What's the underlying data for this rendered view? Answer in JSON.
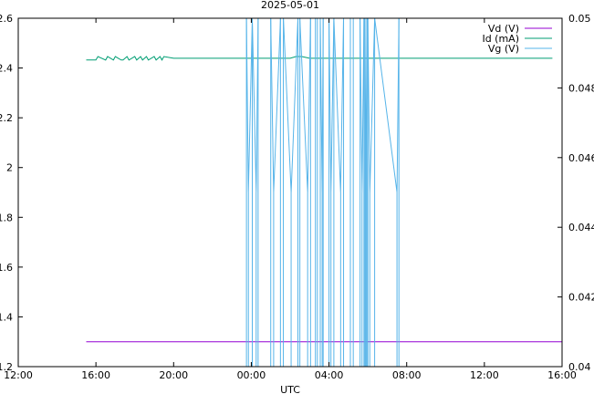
{
  "chart_data": {
    "type": "line",
    "title": "2025-05-01",
    "xlabel": "UTC",
    "ylabel": "",
    "y2label": "",
    "x_ticks": [
      "12:00",
      "16:00",
      "20:00",
      "00:00",
      "04:00",
      "08:00",
      "12:00",
      "16:00"
    ],
    "x_tick_hours": [
      0,
      4,
      8,
      12,
      16,
      20,
      24,
      28
    ],
    "xlim_hours": [
      0,
      28
    ],
    "ylim": [
      1.2,
      2.6
    ],
    "y_ticks": [
      "1.2",
      "1.4",
      "1.6",
      "1.8",
      "2",
      "2.2",
      "2.4",
      "2.6"
    ],
    "y_tick_values": [
      1.2,
      1.4,
      1.6,
      1.8,
      2.0,
      2.2,
      2.4,
      2.6
    ],
    "y2lim": [
      0.04,
      0.05
    ],
    "y2_ticks": [
      "0.04",
      "0.042",
      "0.044",
      "0.046",
      "0.048",
      "0.05"
    ],
    "y2_tick_values": [
      0.04,
      0.042,
      0.044,
      0.046,
      0.048,
      0.05
    ],
    "grid": false,
    "legend_position": "top-right",
    "series": [
      {
        "name": "Vd (V)",
        "color": "#9400d3",
        "axis": "y1",
        "x_hours": [
          3.5,
          28.0
        ],
        "values": [
          1.3,
          1.3
        ]
      },
      {
        "name": "Id (mA)",
        "color": "#009e73",
        "axis": "y2",
        "x_hours": [
          3.5,
          4.0,
          4.1,
          4.5,
          4.6,
          4.9,
          5.0,
          5.3,
          5.4,
          5.6,
          5.7,
          6.0,
          6.1,
          6.3,
          6.4,
          6.6,
          6.7,
          7.0,
          7.1,
          7.3,
          7.4,
          7.5,
          8.0,
          9.0,
          10.0,
          11.0,
          12.0,
          13.0,
          14.0,
          14.3,
          14.6,
          15.0,
          16.0,
          17.0,
          18.0,
          19.0,
          20.0,
          21.0,
          22.0,
          23.0,
          24.0,
          25.0,
          26.0,
          27.0,
          27.5
        ],
        "values": [
          0.0488,
          0.0488,
          0.0489,
          0.0488,
          0.0489,
          0.0488,
          0.0489,
          0.0488,
          0.0488,
          0.0489,
          0.0488,
          0.0489,
          0.0488,
          0.0489,
          0.0488,
          0.0489,
          0.0488,
          0.0489,
          0.0488,
          0.0489,
          0.0488,
          0.0489,
          0.04885,
          0.04885,
          0.04885,
          0.04885,
          0.04885,
          0.04885,
          0.04885,
          0.0489,
          0.0489,
          0.04885,
          0.04885,
          0.04885,
          0.04885,
          0.04885,
          0.04885,
          0.04885,
          0.04885,
          0.04885,
          0.04885,
          0.04885,
          0.04885,
          0.04885,
          0.04885
        ]
      },
      {
        "name": "Vg (V)",
        "color": "#56b4e9",
        "axis": "y1",
        "x_hours": [
          11.75,
          11.85,
          12.05,
          12.25,
          12.35,
          13.0,
          13.15,
          13.5,
          13.65,
          14.05,
          14.4,
          14.5,
          14.9,
          15.05,
          15.3,
          15.4,
          15.55,
          15.65,
          15.7,
          16.0,
          16.1,
          16.25,
          16.6,
          16.75,
          17.1,
          17.25,
          17.6,
          17.7,
          17.8,
          17.85,
          17.9,
          17.95,
          18.0,
          18.1,
          18.35,
          19.5,
          19.6
        ],
        "values": [
          2.6,
          1.9,
          2.6,
          1.9,
          2.6,
          2.6,
          1.9,
          2.6,
          2.6,
          1.9,
          2.6,
          2.6,
          1.9,
          2.6,
          2.6,
          2.6,
          2.6,
          1.9,
          2.6,
          2.6,
          1.9,
          2.6,
          1.9,
          2.6,
          2.6,
          2.6,
          2.6,
          1.9,
          2.6,
          2.6,
          1.9,
          2.6,
          2.6,
          1.9,
          2.6,
          1.9,
          2.6
        ]
      }
    ]
  }
}
